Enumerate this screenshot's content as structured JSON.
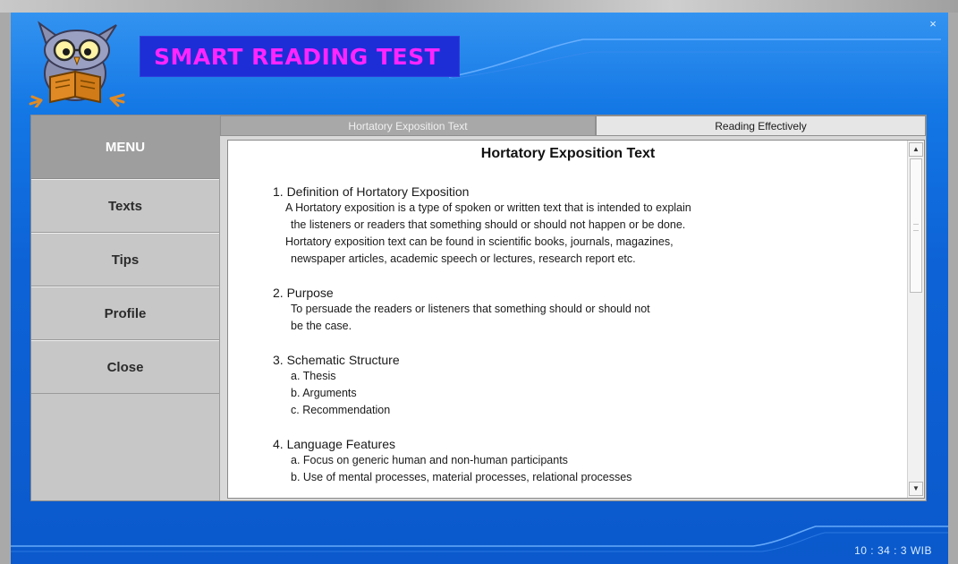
{
  "app": {
    "title": "SMART READING TEST",
    "close_glyph": "×",
    "logo_icon": "owl-reading-book-icon",
    "colors": {
      "background": "#0d63d6",
      "title_box": "#1d2ed6",
      "title_text": "#ff25ff"
    }
  },
  "menu": {
    "header": "MENU",
    "items": [
      {
        "label": "Texts"
      },
      {
        "label": "Tips"
      },
      {
        "label": "Profile"
      },
      {
        "label": "Close"
      }
    ]
  },
  "tabs": [
    {
      "label": "Hortatory Exposition Text",
      "active": true
    },
    {
      "label": "Reading Effectively",
      "active": false
    }
  ],
  "document": {
    "title": "Hortatory Exposition Text",
    "sections": [
      {
        "heading": "1. Definition of Hortatory Exposition",
        "lines": [
          "A Hortatory exposition is a type of spoken or written text that is intended to explain",
          "the listeners or readers that something should or should not happen or be done.",
          "Hortatory exposition text can be found in scientific books, journals, magazines,",
          "newspaper articles, academic speech or lectures, research report etc."
        ]
      },
      {
        "heading": "2. Purpose",
        "lines": [
          "To persuade the readers or listeners that something should or should not",
          "be the case."
        ]
      },
      {
        "heading": "3. Schematic Structure",
        "lines": [
          "a. Thesis",
          "b. Arguments",
          "c. Recommendation"
        ]
      },
      {
        "heading": "4. Language Features",
        "lines": [
          "a. Focus on generic human and non-human participants",
          "b. Use of mental processes, material processes, relational processes"
        ]
      }
    ]
  },
  "scrollbar": {
    "up_icon": "scroll-up-arrow-icon",
    "down_icon": "scroll-down-arrow-icon",
    "up_glyph": "▲",
    "down_glyph": "▼"
  },
  "status": {
    "clock": "10 : 34 : 3  WIB"
  }
}
